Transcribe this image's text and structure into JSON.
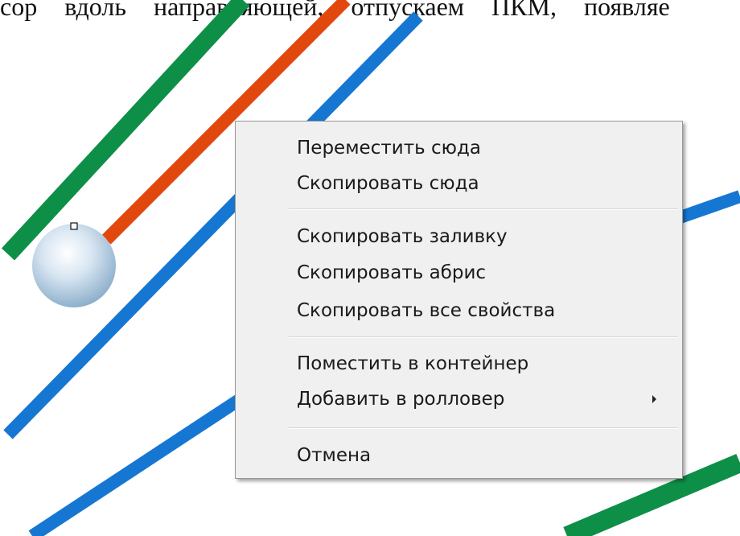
{
  "document": {
    "top_text": "сор вдоль направляющей, отпускаем ПКМ, появляе"
  },
  "canvas": {
    "lines": [
      {
        "name": "green-line-left",
        "color": "#0e8f47"
      },
      {
        "name": "orange-line",
        "color": "#e2480e"
      },
      {
        "name": "blue-line-main",
        "color": "#1677d2"
      },
      {
        "name": "blue-line-right",
        "color": "#1677d2"
      },
      {
        "name": "blue-line-bottom",
        "color": "#1677d2"
      },
      {
        "name": "green-line-bottom-right",
        "color": "#0e8f47"
      }
    ],
    "sphere_color": "#b8d0e4"
  },
  "context_menu": {
    "items": [
      {
        "label": "Переместить сюда"
      },
      {
        "label": "Скопировать сюда"
      },
      {
        "label": "Скопировать заливку"
      },
      {
        "label": "Скопировать абрис"
      },
      {
        "label": "Скопировать все свойства"
      },
      {
        "label": "Поместить в контейнер"
      },
      {
        "label": "Добавить в ролловер",
        "has_submenu": true
      },
      {
        "label": "Отмена"
      }
    ]
  }
}
